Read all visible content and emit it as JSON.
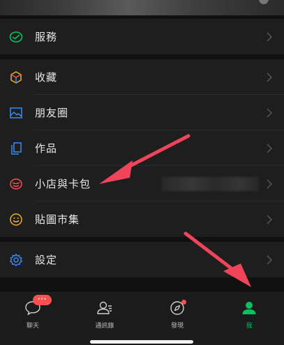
{
  "menu": {
    "services": {
      "label": "服務",
      "icon": "wechat-pay-icon"
    },
    "main_items": [
      {
        "label": "收藏",
        "icon": "favorites-cube-icon"
      },
      {
        "label": "朋友圈",
        "icon": "moments-photo-icon"
      },
      {
        "label": "作品",
        "icon": "works-icon"
      },
      {
        "label": "小店與卡包",
        "icon": "shop-card-icon"
      },
      {
        "label": "貼圖市集",
        "icon": "sticker-smile-icon"
      }
    ],
    "settings": {
      "label": "設定",
      "icon": "gear-icon"
    }
  },
  "tabbar": {
    "tabs": [
      {
        "label": "聊天",
        "icon": "chat-icon",
        "badge": "···"
      },
      {
        "label": "通訊錄",
        "icon": "contacts-icon"
      },
      {
        "label": "發現",
        "icon": "discover-compass-icon"
      },
      {
        "label": "我",
        "icon": "me-person-icon",
        "active": true
      }
    ]
  },
  "colors": {
    "accent": "#07c160",
    "badge": "#fa5151",
    "annotation_arrow": "#f0445a",
    "background": "#111111",
    "row_background": "#1e1e1e"
  }
}
